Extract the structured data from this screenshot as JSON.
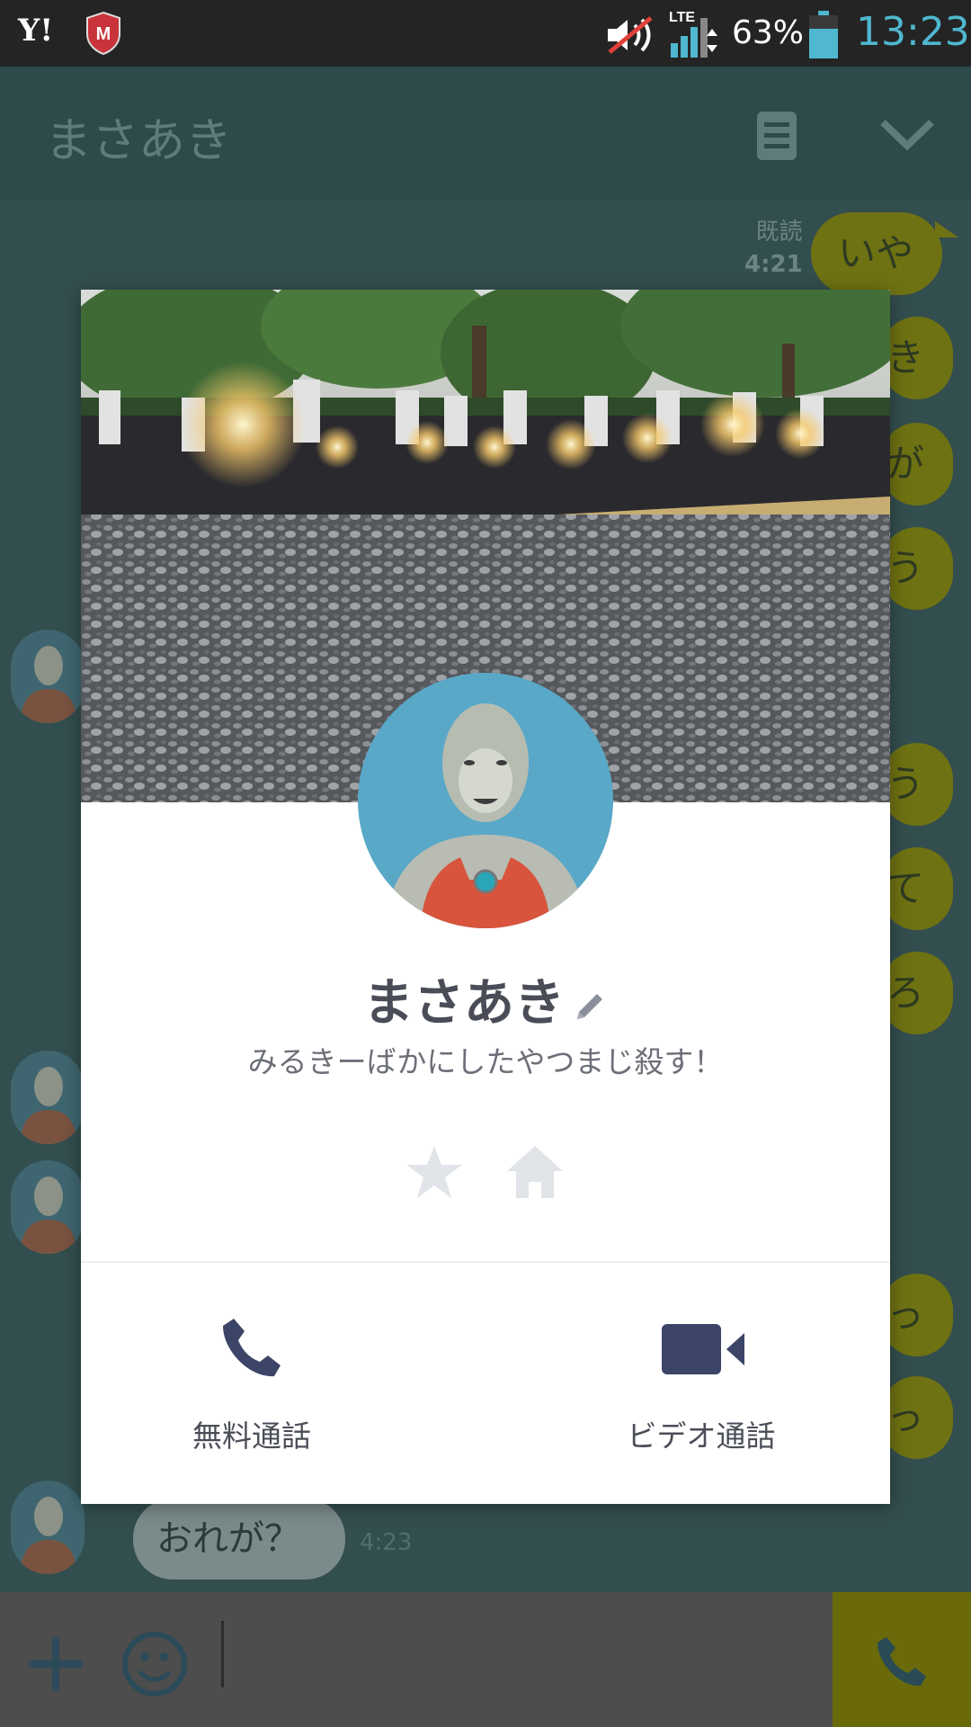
{
  "status_bar": {
    "carrier_logo": "Y!",
    "network": "LTE",
    "battery_percent": "63%",
    "time": "13:23",
    "icons": [
      "yahoo-icon",
      "security-shield-icon",
      "muted-speaker-icon",
      "signal-icon",
      "battery-icon"
    ]
  },
  "header": {
    "title": "まさあき",
    "icons": [
      "note-icon",
      "chevron-down-icon"
    ]
  },
  "chat": {
    "read_label": "既読",
    "read_time": "4:21",
    "right_bubbles": [
      "いや",
      "き",
      "が",
      "う",
      "う",
      "て",
      "ろ",
      "っ",
      "っ"
    ],
    "left_message": "おれが？",
    "left_time": "4:23"
  },
  "profile": {
    "name": "まさあき",
    "status_message": "みるきーばかにしたやつまじ殺す！",
    "actions": [
      {
        "label": "無料通話",
        "icon": "phone-icon"
      },
      {
        "label": "ビデオ通話",
        "icon": "video-camera-icon"
      }
    ]
  },
  "colors": {
    "accent_text": "#4a4d57",
    "clock": "#4fb7cf",
    "bubble_right": "#6f7212",
    "icon_dark": "#3c4467",
    "icon_light": "#e1e4e8"
  }
}
